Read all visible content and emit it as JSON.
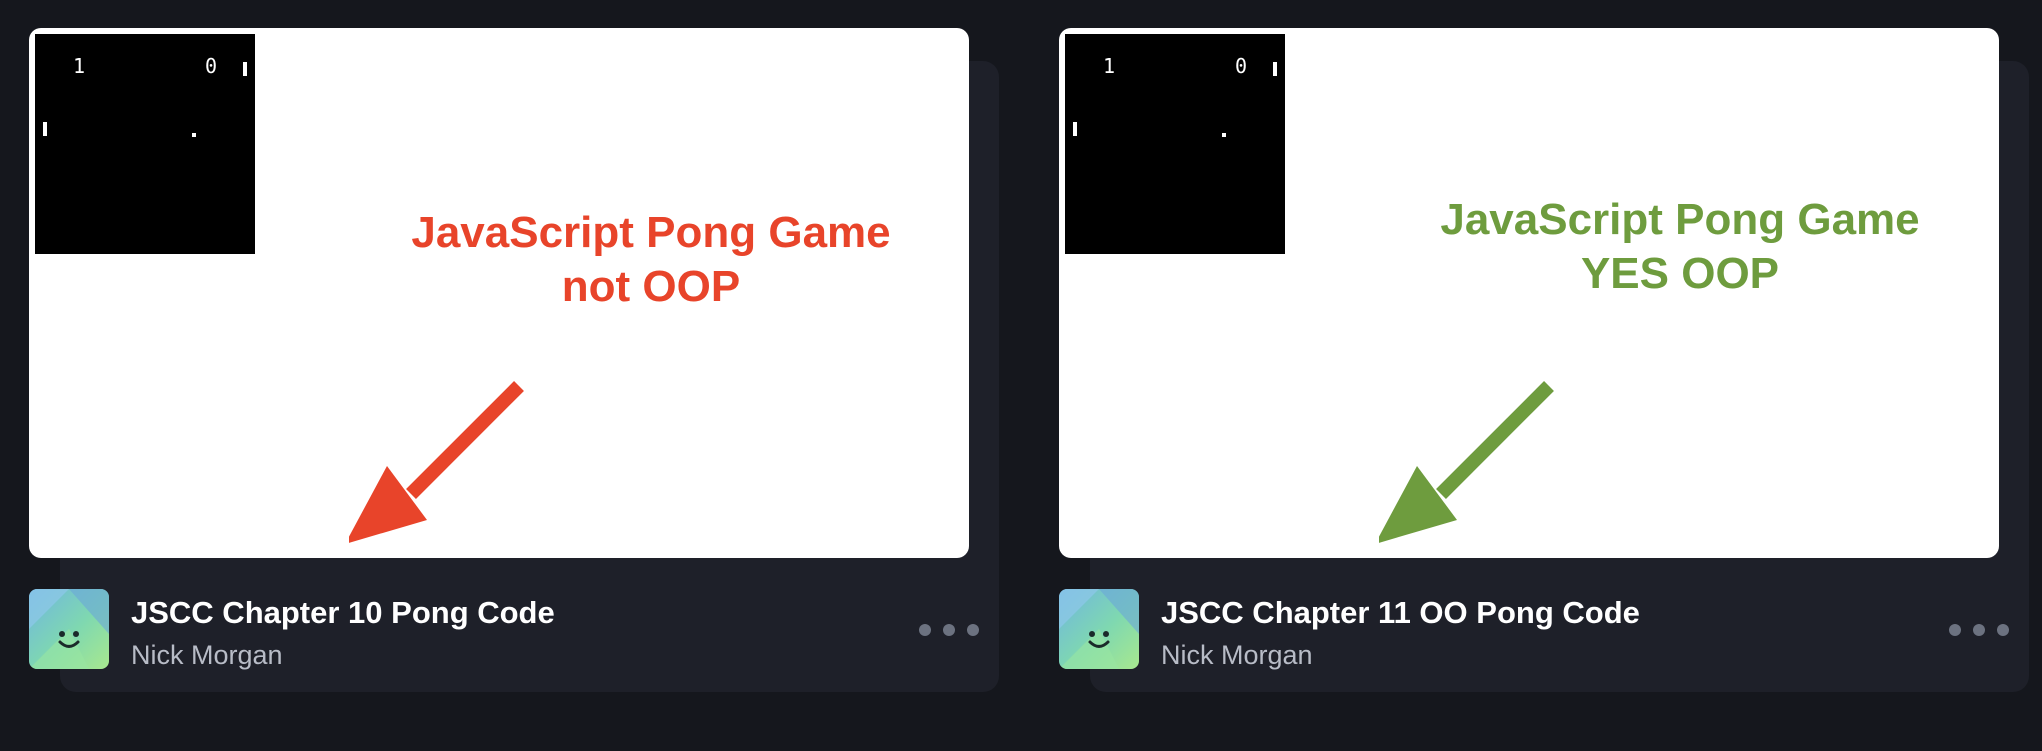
{
  "theme": {
    "background": "#15171d",
    "card_background": "#1e2029",
    "title_color": "#ffffff",
    "author_color": "#b8bcc7"
  },
  "cards": [
    {
      "title": "JSCC Chapter 10 Pong Code",
      "author": "Nick Morgan",
      "thumbnail": {
        "caption_line1": "JavaScript Pong Game",
        "caption_line2": "not OOP",
        "caption_color": "#e8442a",
        "arrow_color": "#e8442a",
        "arrow_icon": "arrow-down-left-icon",
        "game_score_left": "1",
        "game_score_right": "0"
      },
      "avatar_icon": "smiley-avatar-icon",
      "more_icon": "more-horizontal-icon"
    },
    {
      "title": "JSCC Chapter 11 OO Pong Code",
      "author": "Nick Morgan",
      "thumbnail": {
        "caption_line1": "JavaScript Pong Game",
        "caption_line2": "YES OOP",
        "caption_color": "#6e9c3e",
        "arrow_color": "#6e9c3e",
        "arrow_icon": "arrow-down-left-icon",
        "game_score_left": "1",
        "game_score_right": "0"
      },
      "avatar_icon": "smiley-avatar-icon",
      "more_icon": "more-horizontal-icon"
    }
  ]
}
